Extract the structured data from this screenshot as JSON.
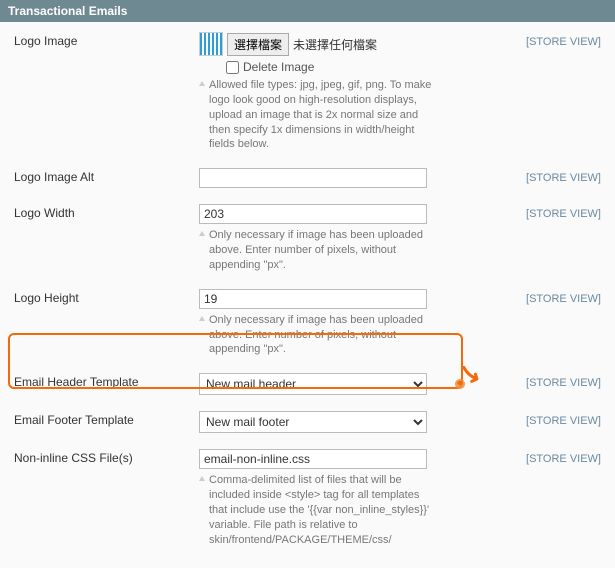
{
  "panel": {
    "title": "Transactional Emails"
  },
  "scope": {
    "label": "[STORE VIEW]"
  },
  "logo_image": {
    "label": "Logo Image",
    "choose_btn": "選擇檔案",
    "no_file": "未選擇任何檔案",
    "delete_label": "Delete Image",
    "hint": "Allowed file types: jpg, jpeg, gif, png. To make logo look good on high-resolution displays, upload an image that is 2x normal size and then specify 1x dimensions in width/height fields below."
  },
  "logo_alt": {
    "label": "Logo Image Alt",
    "value": ""
  },
  "logo_width": {
    "label": "Logo Width",
    "value": "203",
    "hint": "Only necessary if image has been uploaded above. Enter number of pixels, without appending \"px\"."
  },
  "logo_height": {
    "label": "Logo Height",
    "value": "19",
    "hint": "Only necessary if image has been uploaded above. Enter number of pixels, without appending \"px\"."
  },
  "header_tpl": {
    "label": "Email Header Template",
    "value": "New mail header"
  },
  "footer_tpl": {
    "label": "Email Footer Template",
    "value": "New mail footer"
  },
  "css_file": {
    "label": "Non-inline CSS File(s)",
    "value": "email-non-inline.css",
    "hint": "Comma-delimited list of files that will be included inside <style> tag for all templates that include use the '{{var non_inline_styles}}' variable. File path is relative to skin/frontend/PACKAGE/THEME/css/"
  }
}
